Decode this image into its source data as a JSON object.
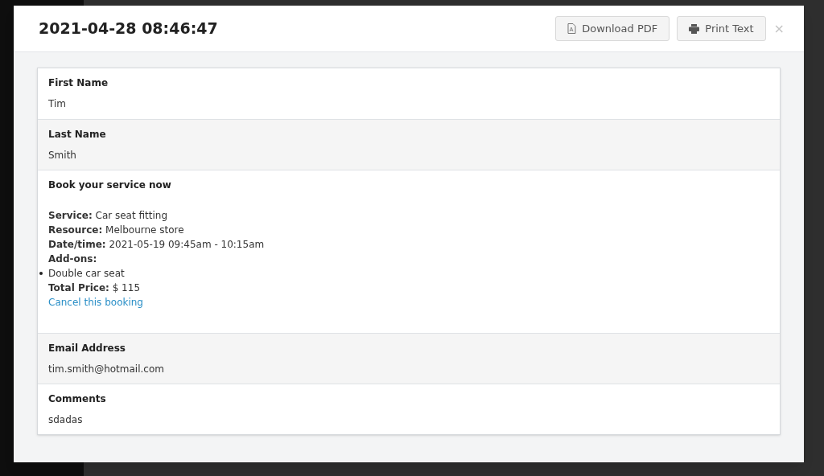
{
  "modal": {
    "title": "2021-04-28 08:46:47",
    "buttons": [
      {
        "label": "Download PDF",
        "kind": "pdf"
      },
      {
        "label": "Print Text",
        "kind": "print"
      }
    ],
    "close": "×"
  },
  "fields": [
    {
      "label": "First Name",
      "kind": "text",
      "value": "Tim"
    },
    {
      "label": "Last Name",
      "kind": "text",
      "value": "Smith"
    },
    {
      "label": "Book your service now",
      "kind": "booking",
      "lines": [
        {
          "kind": "pair",
          "text": "**Service:** Car seat fitting"
        },
        {
          "kind": "pair",
          "text": "**Resource:** Melbourne store"
        },
        {
          "kind": "pair",
          "text": "**Date/time:** 2021-05-19 09:45am - 10:15am"
        },
        {
          "kind": "heading",
          "text": "Add-ons:"
        },
        {
          "kind": "bullet",
          "text": "Double car seat"
        },
        {
          "kind": "pair",
          "text": "**Total Price:** $ 115"
        },
        {
          "kind": "link",
          "text": "Cancel this booking"
        }
      ]
    },
    {
      "label": "Email Address",
      "kind": "text",
      "value": "tim.smith@hotmail.com"
    },
    {
      "label": "Comments",
      "kind": "text",
      "value": "sdadas"
    }
  ]
}
